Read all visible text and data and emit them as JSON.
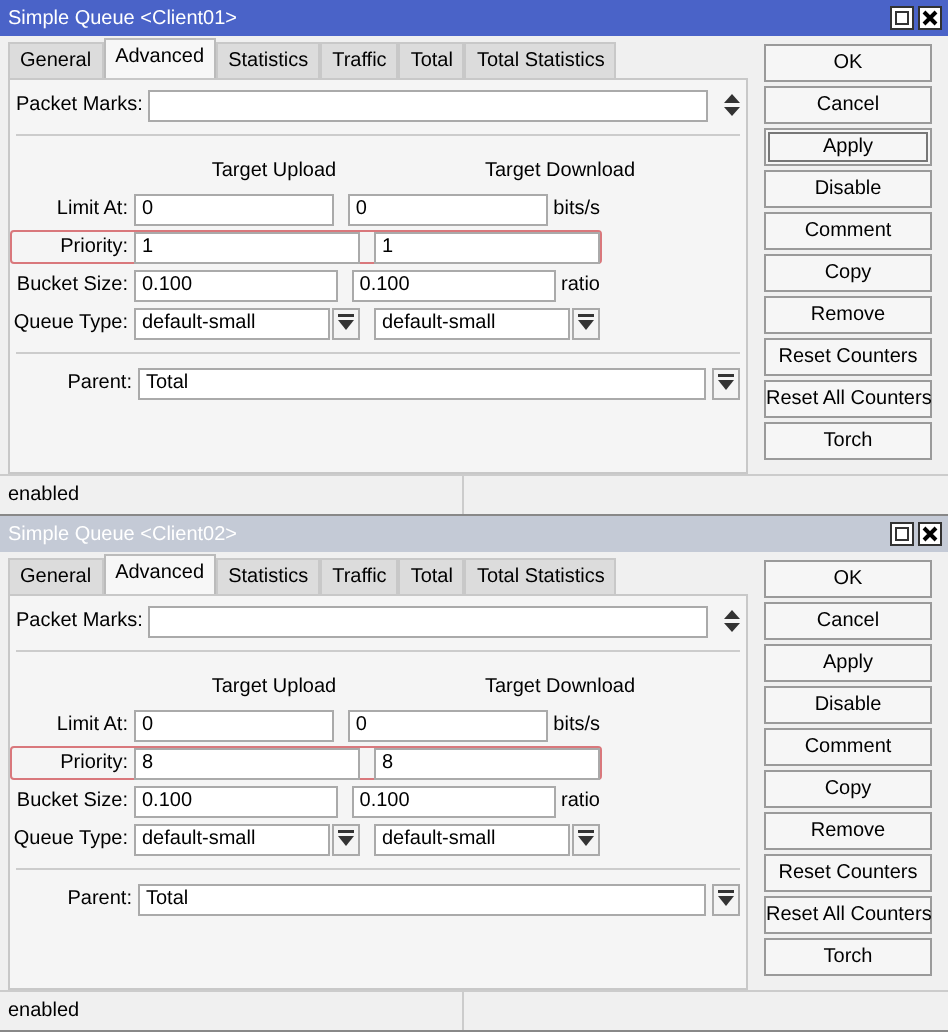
{
  "windows": [
    {
      "title": "Simple Queue <Client01>",
      "active": true,
      "tabs": [
        {
          "label": "General",
          "selected": false
        },
        {
          "label": "Advanced",
          "selected": true
        },
        {
          "label": "Statistics",
          "selected": false
        },
        {
          "label": "Traffic",
          "selected": false
        },
        {
          "label": "Total",
          "selected": false
        },
        {
          "label": "Total Statistics",
          "selected": false
        }
      ],
      "packet_marks": {
        "label": "Packet Marks:"
      },
      "columns": [
        "Target Upload",
        "Target Download"
      ],
      "rows": [
        {
          "kind": "text",
          "label": "Limit At:",
          "values": [
            "0",
            "0"
          ],
          "unit": "bits/s",
          "highlighted": false
        },
        {
          "kind": "text",
          "label": "Priority:",
          "values": [
            "1",
            "1"
          ],
          "highlighted": true
        },
        {
          "kind": "text",
          "label": "Bucket Size:",
          "values": [
            "0.100",
            "0.100"
          ],
          "unit": "ratio",
          "highlighted": false
        },
        {
          "kind": "dropdown",
          "label": "Queue Type:",
          "values": [
            "default-small",
            "default-small"
          ],
          "highlighted": false
        }
      ],
      "parent": {
        "label": "Parent:",
        "value": "Total"
      },
      "buttons": [
        {
          "label": "OK",
          "focused": false
        },
        {
          "label": "Cancel",
          "focused": false
        },
        {
          "label": "Apply",
          "focused": true
        },
        {
          "label": "Disable",
          "focused": false
        },
        {
          "label": "Comment",
          "focused": false
        },
        {
          "label": "Copy",
          "focused": false
        },
        {
          "label": "Remove",
          "focused": false
        },
        {
          "label": "Reset Counters",
          "focused": false
        },
        {
          "label": "Reset All Counters",
          "focused": false
        },
        {
          "label": "Torch",
          "focused": false
        }
      ],
      "status_bar": "enabled"
    },
    {
      "title": "Simple Queue <Client02>",
      "active": false,
      "tabs": [
        {
          "label": "General",
          "selected": false
        },
        {
          "label": "Advanced",
          "selected": true
        },
        {
          "label": "Statistics",
          "selected": false
        },
        {
          "label": "Traffic",
          "selected": false
        },
        {
          "label": "Total",
          "selected": false
        },
        {
          "label": "Total Statistics",
          "selected": false
        }
      ],
      "packet_marks": {
        "label": "Packet Marks:"
      },
      "columns": [
        "Target Upload",
        "Target Download"
      ],
      "rows": [
        {
          "kind": "text",
          "label": "Limit At:",
          "values": [
            "0",
            "0"
          ],
          "unit": "bits/s",
          "highlighted": false
        },
        {
          "kind": "text",
          "label": "Priority:",
          "values": [
            "8",
            "8"
          ],
          "highlighted": true
        },
        {
          "kind": "text",
          "label": "Bucket Size:",
          "values": [
            "0.100",
            "0.100"
          ],
          "unit": "ratio",
          "highlighted": false
        },
        {
          "kind": "dropdown",
          "label": "Queue Type:",
          "values": [
            "default-small",
            "default-small"
          ],
          "highlighted": false
        }
      ],
      "parent": {
        "label": "Parent:",
        "value": "Total"
      },
      "buttons": [
        {
          "label": "OK",
          "focused": false
        },
        {
          "label": "Cancel",
          "focused": false
        },
        {
          "label": "Apply",
          "focused": false
        },
        {
          "label": "Disable",
          "focused": false
        },
        {
          "label": "Comment",
          "focused": false
        },
        {
          "label": "Copy",
          "focused": false
        },
        {
          "label": "Remove",
          "focused": false
        },
        {
          "label": "Reset Counters",
          "focused": false
        },
        {
          "label": "Reset All Counters",
          "focused": false
        },
        {
          "label": "Torch",
          "focused": false
        }
      ],
      "status_bar": "enabled"
    }
  ]
}
